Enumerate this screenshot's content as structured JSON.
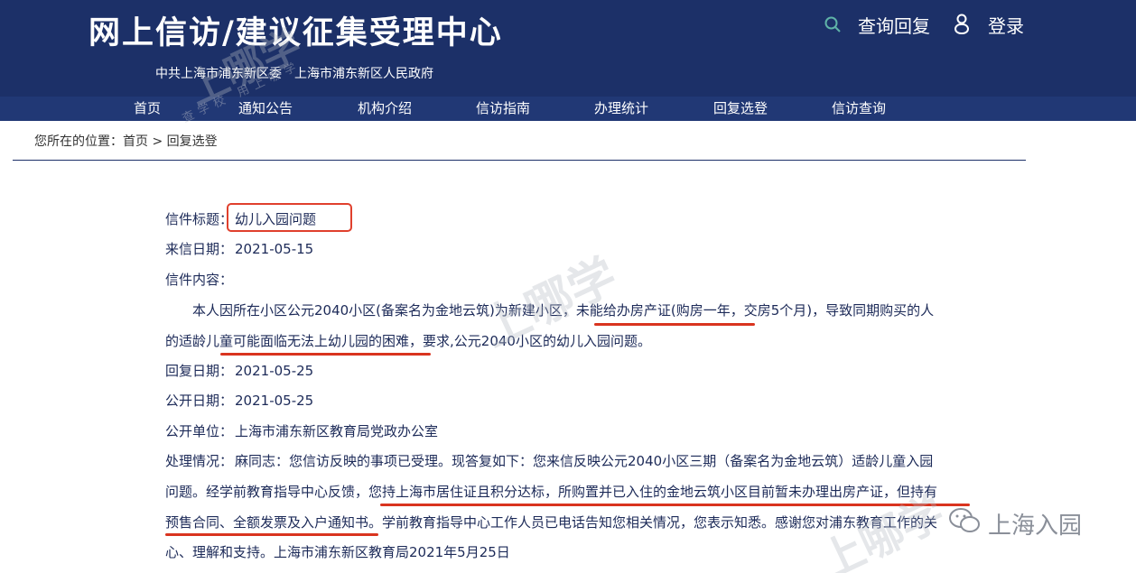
{
  "header": {
    "site_title": "网上信访/建议征集受理中心",
    "subtitle_left": "中共上海市浦东新区委",
    "subtitle_right": "上海市浦东新区人民政府",
    "query_label": "查询回复",
    "login_label": "登录"
  },
  "nav": {
    "items": [
      "首页",
      "通知公告",
      "机构介绍",
      "信访指南",
      "办理统计",
      "回复选登",
      "信访查询"
    ]
  },
  "breadcrumb": {
    "prefix": "您所在的位置：",
    "home": "首页",
    "separator": ">",
    "current": "回复选登"
  },
  "letter": {
    "title_label": "信件标题：",
    "title_value": "幼儿入园问题",
    "received_label": "来信日期：",
    "received_value": "2021-05-15",
    "content_label": "信件内容：",
    "content_line1": "本人因所在小区公元2040小区(备案名为金地云筑)为新建小区，未能给办房产证(购房一年，交房5个月)，导致同期购买的人",
    "content_line2": "的适龄儿童可能面临无法上幼儿园的困难，要求,公元2040小区的幼儿入园问题。",
    "reply_date_label": "回复日期：",
    "reply_date_value": "2021-05-25",
    "public_date_label": "公开日期：",
    "public_date_value": "2021-05-25",
    "public_unit_label": "公开单位：",
    "public_unit_value": "上海市浦东新区教育局党政办公室",
    "handling_label": "处理情况：",
    "handling_line1": "麻同志：您信访反映的事项已受理。现答复如下：您来信反映公元2040小区三期（备案名为金地云筑）适龄儿童入园",
    "handling_line2": "问题。经学前教育指导中心反馈，您持上海市居住证且积分达标，所购置并已入住的金地云筑小区目前暂未办理出房产证，但持有",
    "handling_line3": "预售合同、全额发票及入户通知书。学前教育指导中心工作人员已电话告知您相关情况，您表示知悉。感谢您对浦东教育工作的关",
    "handling_line4": "心、理解和支持。上海市浦东新区教育局2021年5月25日"
  },
  "watermark": {
    "brand": "上哪学",
    "small_text": "查学校 用上哪学",
    "badge": "上海入园"
  },
  "colors": {
    "header_bg": "#1c3068",
    "nav_bg": "#213875",
    "text_primary": "#1c2a58",
    "highlight_red": "#d9341f"
  },
  "icons": {
    "search": "search-icon",
    "user": "user-icon",
    "wechat": "wechat-icon"
  }
}
